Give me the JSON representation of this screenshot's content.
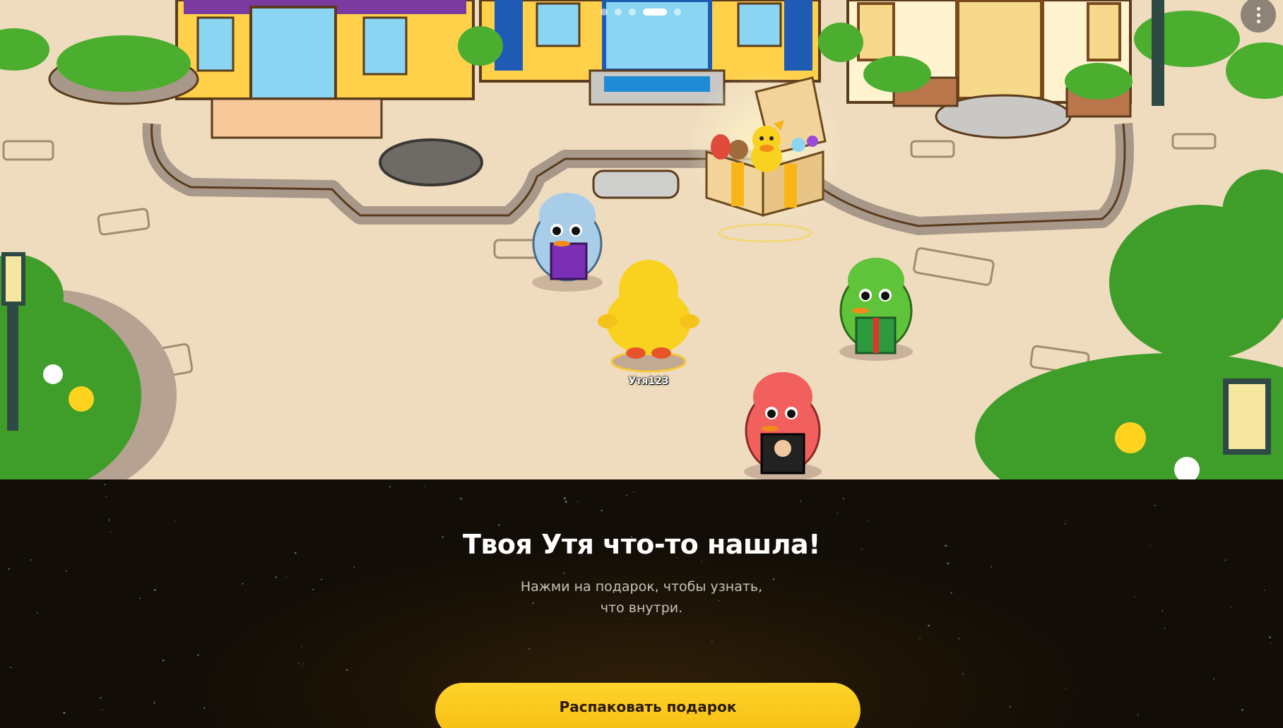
{
  "story": {
    "progress": {
      "total": 5,
      "current": 4
    },
    "menu_icon": "more-vertical-icon"
  },
  "scene": {
    "player_name": "Утя123",
    "ducks": [
      {
        "color": "#a8cde8",
        "item": "purple gift box"
      },
      {
        "color": "#f9d11f",
        "item": "none"
      },
      {
        "color": "#5fc43a",
        "item": "green gift box"
      },
      {
        "color": "#f2605e",
        "item": "black gift box"
      }
    ],
    "gift": {
      "icon": "gift-box-icon"
    }
  },
  "panel": {
    "title": "Твоя Утя что-то нашла!",
    "subtitle_line1": "Нажми на подарок, чтобы узнать,",
    "subtitle_line2": "что внутри.",
    "cta_label": "Распаковать подарок"
  },
  "colors": {
    "accent": "#f9c51a",
    "panel_bg": "#120d06",
    "title": "#ffffff",
    "subtitle": "#c9c2b6"
  }
}
